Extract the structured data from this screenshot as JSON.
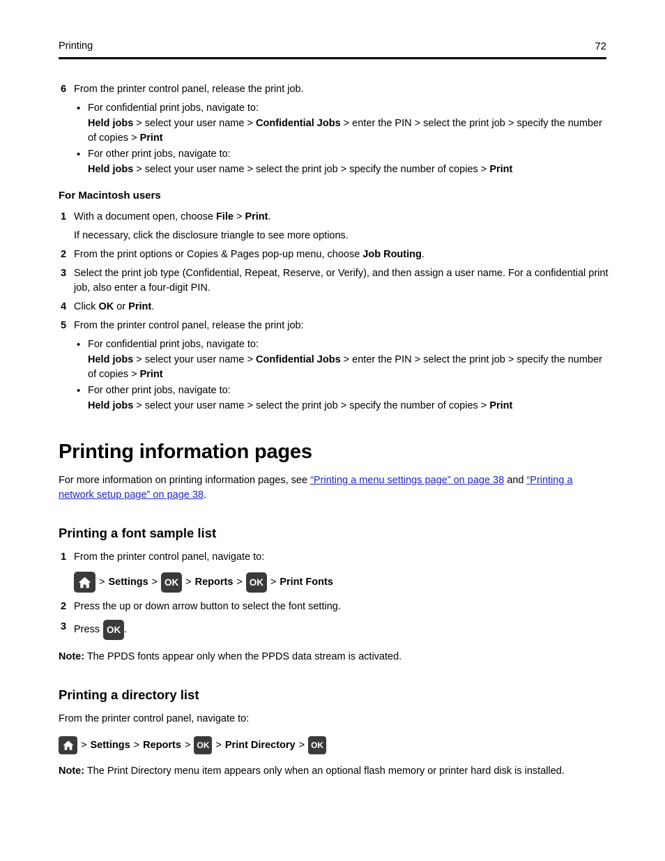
{
  "header": {
    "title": "Printing",
    "page_number": "72"
  },
  "icons": {
    "home": "home-icon",
    "ok": "OK"
  },
  "separator": ">",
  "bullet_glyph": "•",
  "colors": {
    "link": "#2222cc",
    "key_background": "#3a3a3a",
    "text": "#000000"
  },
  "step6": {
    "number": "6",
    "text": "From the printer control panel, release the print job.",
    "bullets": [
      {
        "lead": "For confidential print jobs, navigate to:",
        "path": [
          {
            "text": "Held jobs",
            "bold": true
          },
          {
            "text": "select your user name",
            "bold": false
          },
          {
            "text": "Confidential Jobs",
            "bold": true
          },
          {
            "text": "enter the PIN",
            "bold": false
          },
          {
            "text": "select the print job",
            "bold": false
          },
          {
            "text": "specify the number of copies",
            "bold": false
          },
          {
            "text": "Print",
            "bold": true
          }
        ]
      },
      {
        "lead": "For other print jobs, navigate to:",
        "path": [
          {
            "text": "Held jobs",
            "bold": true
          },
          {
            "text": "select your user name",
            "bold": false
          },
          {
            "text": "select the print job",
            "bold": false
          },
          {
            "text": "specify the number of copies",
            "bold": false
          },
          {
            "text": "Print",
            "bold": true
          }
        ]
      }
    ]
  },
  "macintosh": {
    "heading": "For Macintosh users",
    "steps": [
      {
        "number": "1",
        "rich": [
          {
            "text": "With a document open, choose ",
            "bold": false
          },
          {
            "text": "File",
            "bold": true
          },
          {
            "text": " > ",
            "bold": false
          },
          {
            "text": "Print",
            "bold": true
          },
          {
            "text": ".",
            "bold": false
          }
        ],
        "sub": "If necessary, click the disclosure triangle to see more options."
      },
      {
        "number": "2",
        "rich": [
          {
            "text": "From the print options or Copies & Pages pop-up menu, choose ",
            "bold": false
          },
          {
            "text": "Job Routing",
            "bold": true
          },
          {
            "text": ".",
            "bold": false
          }
        ]
      },
      {
        "number": "3",
        "rich": [
          {
            "text": "Select the print job type (Confidential, Repeat, Reserve, or Verify), and then assign a user name. For a confidential print job, also enter a four-digit PIN.",
            "bold": false
          }
        ]
      },
      {
        "number": "4",
        "rich": [
          {
            "text": "Click ",
            "bold": false
          },
          {
            "text": "OK",
            "bold": true
          },
          {
            "text": " or ",
            "bold": false
          },
          {
            "text": "Print",
            "bold": true
          },
          {
            "text": ".",
            "bold": false
          }
        ]
      }
    ],
    "step5": {
      "number": "5",
      "text": "From the printer control panel, release the print job:",
      "bullets": [
        {
          "lead": "For confidential print jobs, navigate to:",
          "path": [
            {
              "text": "Held jobs",
              "bold": true
            },
            {
              "text": "select your user name",
              "bold": false
            },
            {
              "text": "Confidential Jobs",
              "bold": true
            },
            {
              "text": "enter the PIN",
              "bold": false
            },
            {
              "text": "select the print job",
              "bold": false
            },
            {
              "text": "specify the number of copies",
              "bold": false
            },
            {
              "text": "Print",
              "bold": true
            }
          ]
        },
        {
          "lead": "For other print jobs, navigate to:",
          "path": [
            {
              "text": "Held jobs",
              "bold": true
            },
            {
              "text": "select your user name",
              "bold": false
            },
            {
              "text": "select the print job",
              "bold": false
            },
            {
              "text": "specify the number of copies",
              "bold": false
            },
            {
              "text": "Print",
              "bold": true
            }
          ]
        }
      ]
    }
  },
  "info_pages": {
    "heading": "Printing information pages",
    "intro_prefix": "For more information on printing information pages, see ",
    "link1": "“Printing a menu settings page” on page 38",
    "intro_middle": " and ",
    "link2": "“Printing a network setup page” on page 38",
    "intro_suffix": "."
  },
  "font_sample": {
    "heading": "Printing a font sample list",
    "step1": {
      "number": "1",
      "text": "From the printer control panel, navigate to:",
      "nav": [
        {
          "kind": "home"
        },
        {
          "kind": "sep"
        },
        {
          "kind": "label",
          "text": "Settings"
        },
        {
          "kind": "sep"
        },
        {
          "kind": "ok"
        },
        {
          "kind": "sep"
        },
        {
          "kind": "label",
          "text": "Reports"
        },
        {
          "kind": "sep"
        },
        {
          "kind": "ok"
        },
        {
          "kind": "sep"
        },
        {
          "kind": "label",
          "text": "Print Fonts"
        }
      ]
    },
    "step2": {
      "number": "2",
      "text": "Press the up or down arrow button to select the font setting."
    },
    "step3": {
      "number": "3",
      "prefix": "Press",
      "suffix": "."
    },
    "note_label": "Note:",
    "note_text": " The PPDS fonts appear only when the PPDS data stream is activated."
  },
  "directory": {
    "heading": "Printing a directory list",
    "intro": "From the printer control panel, navigate to:",
    "nav": [
      {
        "kind": "home"
      },
      {
        "kind": "sep"
      },
      {
        "kind": "label",
        "text": "Settings"
      },
      {
        "kind": "sep"
      },
      {
        "kind": "label",
        "text": "Reports"
      },
      {
        "kind": "sep"
      },
      {
        "kind": "ok"
      },
      {
        "kind": "sep"
      },
      {
        "kind": "label",
        "text": "Print Directory"
      },
      {
        "kind": "sep"
      },
      {
        "kind": "ok"
      }
    ],
    "note_label": "Note:",
    "note_text": " The Print Directory menu item appears only when an optional flash memory or printer hard disk is installed."
  }
}
